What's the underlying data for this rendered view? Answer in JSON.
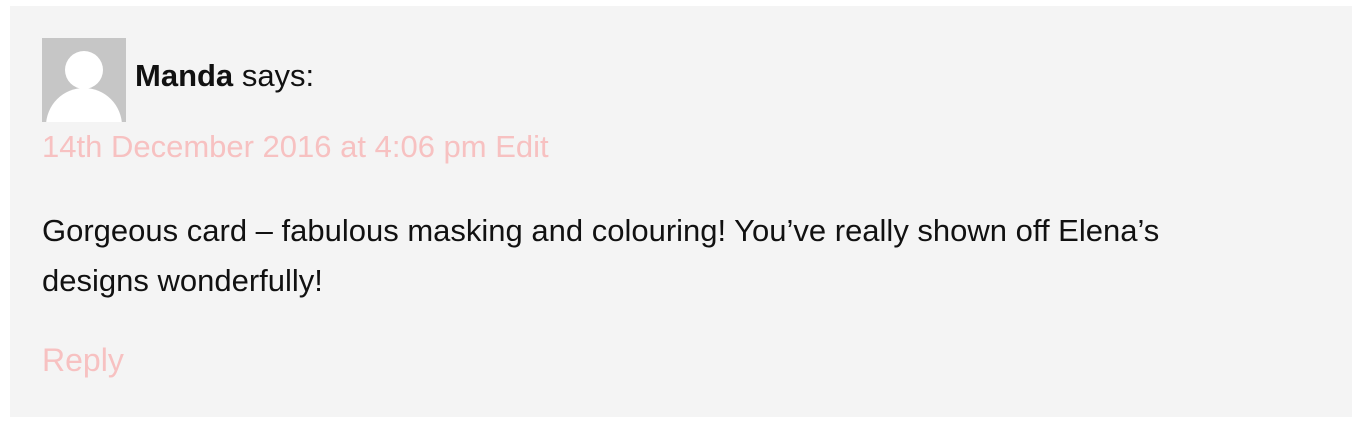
{
  "comment": {
    "author": "Manda",
    "says_label": "says:",
    "date": "14th December 2016 at 4:06 pm",
    "edit_label": "Edit",
    "text": "Gorgeous card – fabulous masking and colouring! You’ve really shown off Elena’s designs wonderfully!",
    "reply_label": "Reply",
    "avatar_icon": "default-user-avatar-icon"
  },
  "colors": {
    "background": "#f4f4f4",
    "link": "#f7c1c1",
    "text": "#111111",
    "avatar_bg": "#c6c6c6"
  }
}
